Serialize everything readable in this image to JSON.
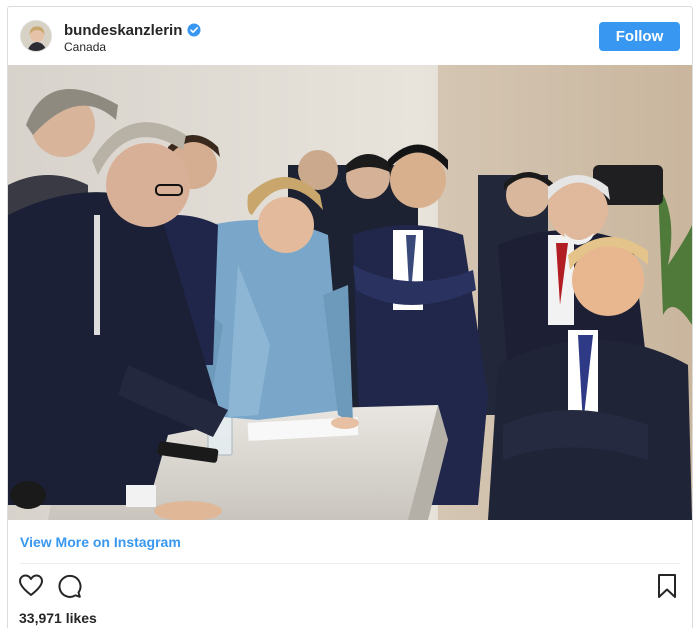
{
  "post": {
    "username": "bundeskanzlerin",
    "location": "Canada",
    "follow_label": "Follow",
    "view_more_label": "View More on Instagram",
    "likes_text": "33,971 likes"
  },
  "icons": {
    "verified": "verified-badge-icon",
    "like": "heart-icon",
    "comment": "comment-icon",
    "save": "bookmark-icon"
  },
  "colors": {
    "accent": "#3897f0",
    "text": "#262626",
    "border": "#dbdbdb"
  }
}
